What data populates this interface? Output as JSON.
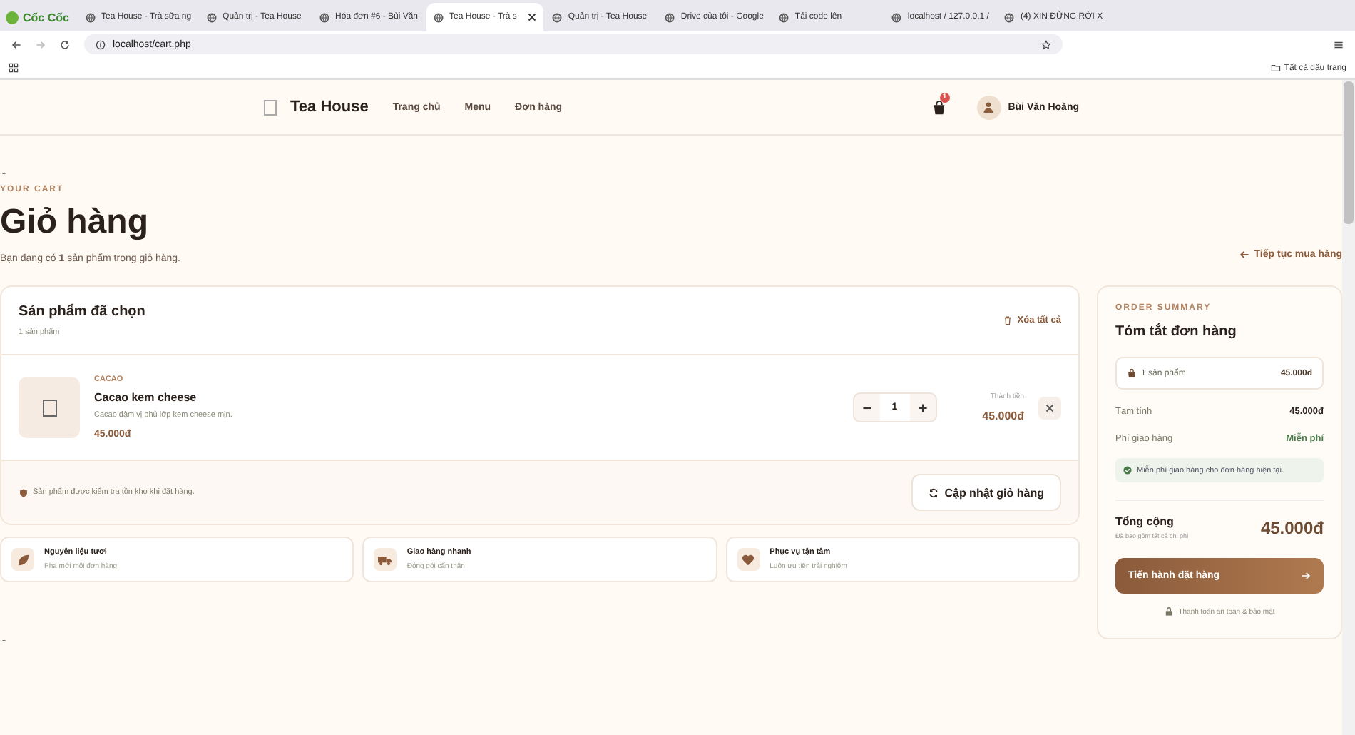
{
  "browser": {
    "name": "Cốc Cốc",
    "tabs": [
      {
        "title": "Tea House - Trà sữa ng",
        "selected": false
      },
      {
        "title": "Quản trị - Tea House",
        "selected": false
      },
      {
        "title": "Hóa đơn #6 - Bùi Văn",
        "selected": false
      },
      {
        "title": "Tea House - Trà s",
        "selected": true
      },
      {
        "title": "Quản trị - Tea House",
        "selected": false
      },
      {
        "title": "Drive của tôi - Google",
        "selected": false
      },
      {
        "title": "Tải code lên",
        "selected": false
      },
      {
        "title": "localhost / 127.0.0.1 /",
        "selected": false
      },
      {
        "title": "(4) XIN ĐỪNG RỜI X",
        "selected": false
      }
    ],
    "url": "localhost/cart.php",
    "bookmarks_label": "Tất cả dấu trang"
  },
  "header": {
    "brand": "Tea House",
    "nav": [
      "Trang chủ",
      "Menu",
      "Đơn hàng"
    ],
    "cart_badge": "1",
    "user": "Bùi Văn Hoàng"
  },
  "page_marks": [
    "...",
    "..."
  ],
  "hero": {
    "eyebrow": "YOUR CART",
    "title": "Giỏ hàng",
    "subtitle": "Bạn đang có **1** sản phẩm trong giỏ hàng.",
    "back_link": "Tiếp tục mua hàng"
  },
  "cart": {
    "title": "Sản phẩm đã chọn",
    "count": "1 sản phẩm",
    "clear": "Xóa tất cả",
    "items": [
      {
        "category": "CACAO",
        "name": "Cacao kem cheese",
        "description": "Cacao đậm vị phủ lớp kem cheese mịn.",
        "price": "45.000đ",
        "quantity": "1",
        "subtotal_label": "Thành tiền",
        "subtotal": "45.000đ"
      }
    ],
    "note": "Sản phẩm được kiểm tra tồn kho khi đặt hàng.",
    "update_button": "Cập nhật giỏ hàng"
  },
  "features": [
    {
      "kind": "leaf",
      "title": "Nguyên liệu tươi",
      "text": "Pha mới mỗi đơn hàng"
    },
    {
      "kind": "truck",
      "title": "Giao hàng nhanh",
      "text": "Đóng gói cẩn thận"
    },
    {
      "kind": "heart",
      "title": "Phục vụ tận tâm",
      "text": "Luôn ưu tiên trải nghiệm"
    }
  ],
  "summary": {
    "eyebrow": "ORDER SUMMARY",
    "title": "Tóm tắt đơn hàng",
    "items_label": "1 sản phẩm",
    "items_total": "45.000đ",
    "rows": [
      {
        "label": "Tạm tính",
        "value": "45.000đ",
        "kind": "plain"
      },
      {
        "label": "Phí giao hàng",
        "value": "Miễn phí",
        "kind": "free"
      }
    ],
    "notice": "Miễn phí giao hàng cho đơn hàng hiện tại.",
    "total_label": "Tổng cộng",
    "total_note": "Đã bao gồm tất cả chi phí",
    "total": "45.000đ",
    "checkout": "Tiến hành đặt hàng",
    "secure": "Thanh toán an toàn & bảo mật"
  }
}
